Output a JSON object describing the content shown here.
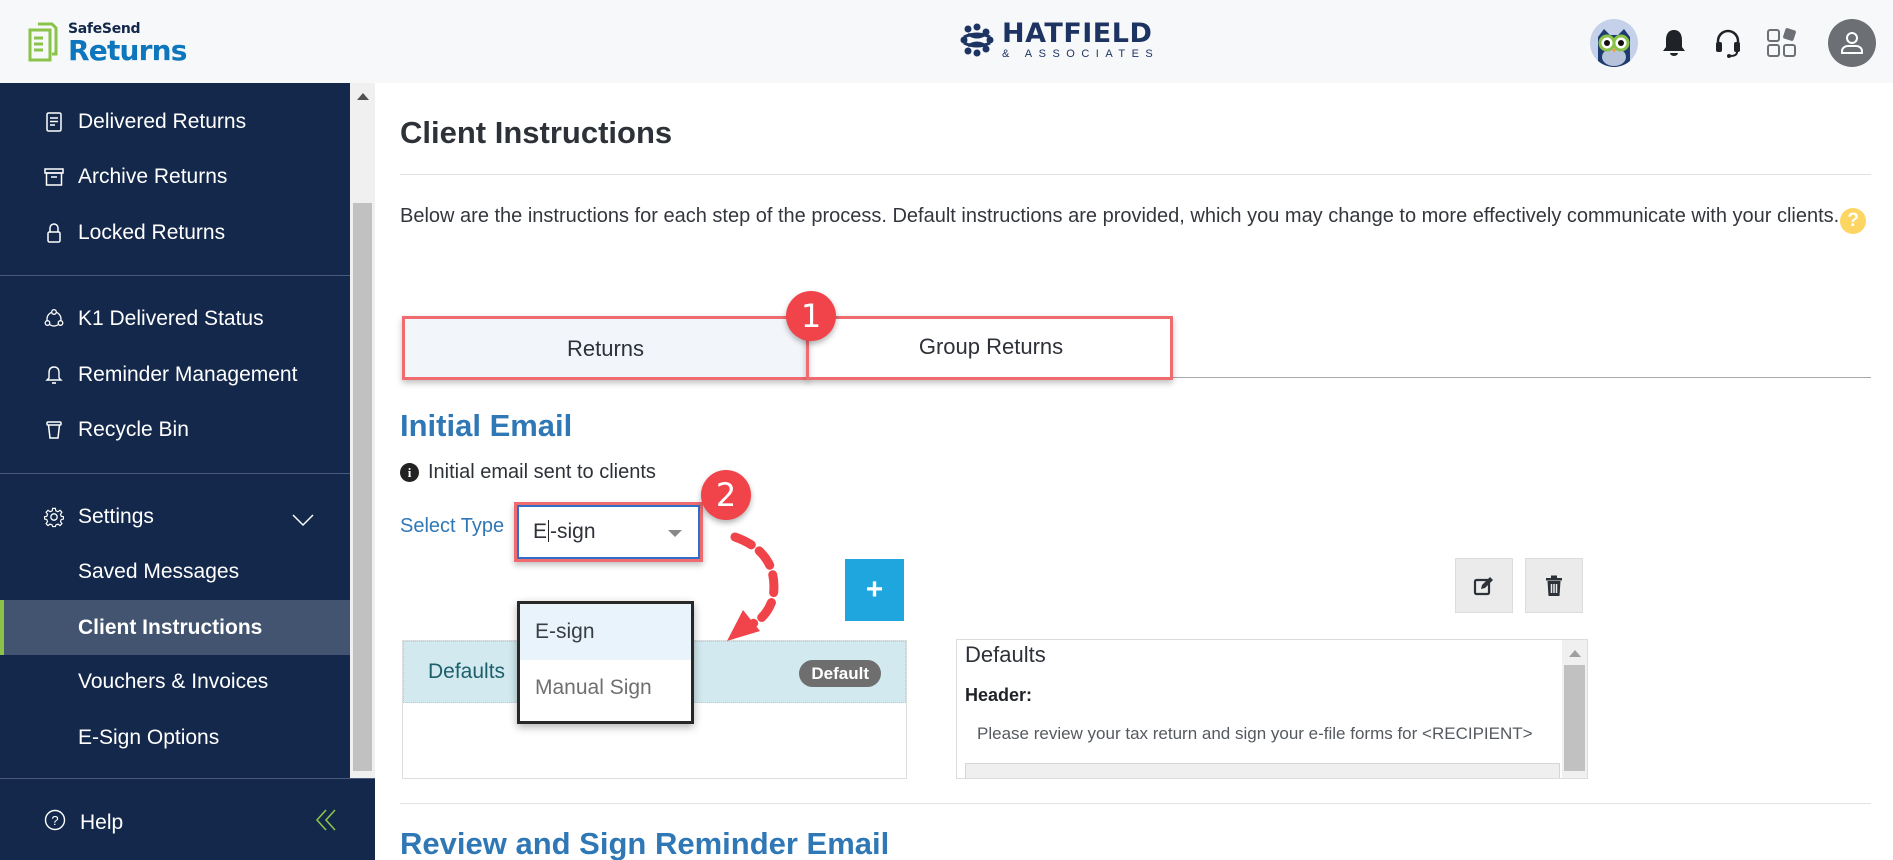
{
  "header": {
    "brand_top": "SafeSend",
    "brand_bottom": "Returns",
    "firm_name": "HATFIELD",
    "firm_sub": "& ASSOCIATES",
    "icons": [
      "owl-avatar-icon",
      "bell-icon",
      "headset-icon",
      "apps-grid-icon",
      "user-avatar-icon"
    ]
  },
  "sidebar": {
    "items": [
      {
        "label": "Delivered Returns",
        "icon": "document-icon"
      },
      {
        "label": "Archive Returns",
        "icon": "archive-box-icon"
      },
      {
        "label": "Locked Returns",
        "icon": "lock-icon"
      },
      {
        "label": "K1 Delivered Status",
        "icon": "network-icon"
      },
      {
        "label": "Reminder Management",
        "icon": "bell-icon"
      },
      {
        "label": "Recycle Bin",
        "icon": "bin-icon"
      },
      {
        "label": "Settings",
        "icon": "gear-icon",
        "expanded": true
      }
    ],
    "sub_items": [
      {
        "label": "Saved Messages",
        "active": false
      },
      {
        "label": "Client Instructions",
        "active": true
      },
      {
        "label": "Vouchers & Invoices",
        "active": false
      },
      {
        "label": "E-Sign Options",
        "active": false
      }
    ],
    "help_label": "Help",
    "accent_color": "#8bc34a"
  },
  "main": {
    "title": "Client Instructions",
    "description": "Below are the instructions for each step of the process. Default instructions are provided, which you may change to more effectively communicate with your clients.",
    "help_glyph": "?",
    "tabs": [
      {
        "label": "Returns",
        "active": true
      },
      {
        "label": "Group Returns",
        "active": false
      }
    ],
    "annotations": {
      "step1": "1",
      "step2": "2",
      "highlight_color": "#ef6b6f",
      "badge_color": "#f1434a"
    },
    "initial_email": {
      "title": "Initial Email",
      "info": "Initial email sent to clients",
      "select_label": "Select Type",
      "select_value_pre": "E",
      "select_value_post": "-sign",
      "options": [
        "E-sign",
        "Manual Sign"
      ],
      "add_glyph": "+",
      "list": [
        {
          "name": "Defaults",
          "badge": "Default"
        }
      ],
      "preview": {
        "title": "Defaults",
        "header_label": "Header:",
        "header_text": "Please review your tax return and sign your e-file forms for <RECIPIENT>"
      }
    },
    "next_section_title": "Review and Sign Reminder Email"
  }
}
